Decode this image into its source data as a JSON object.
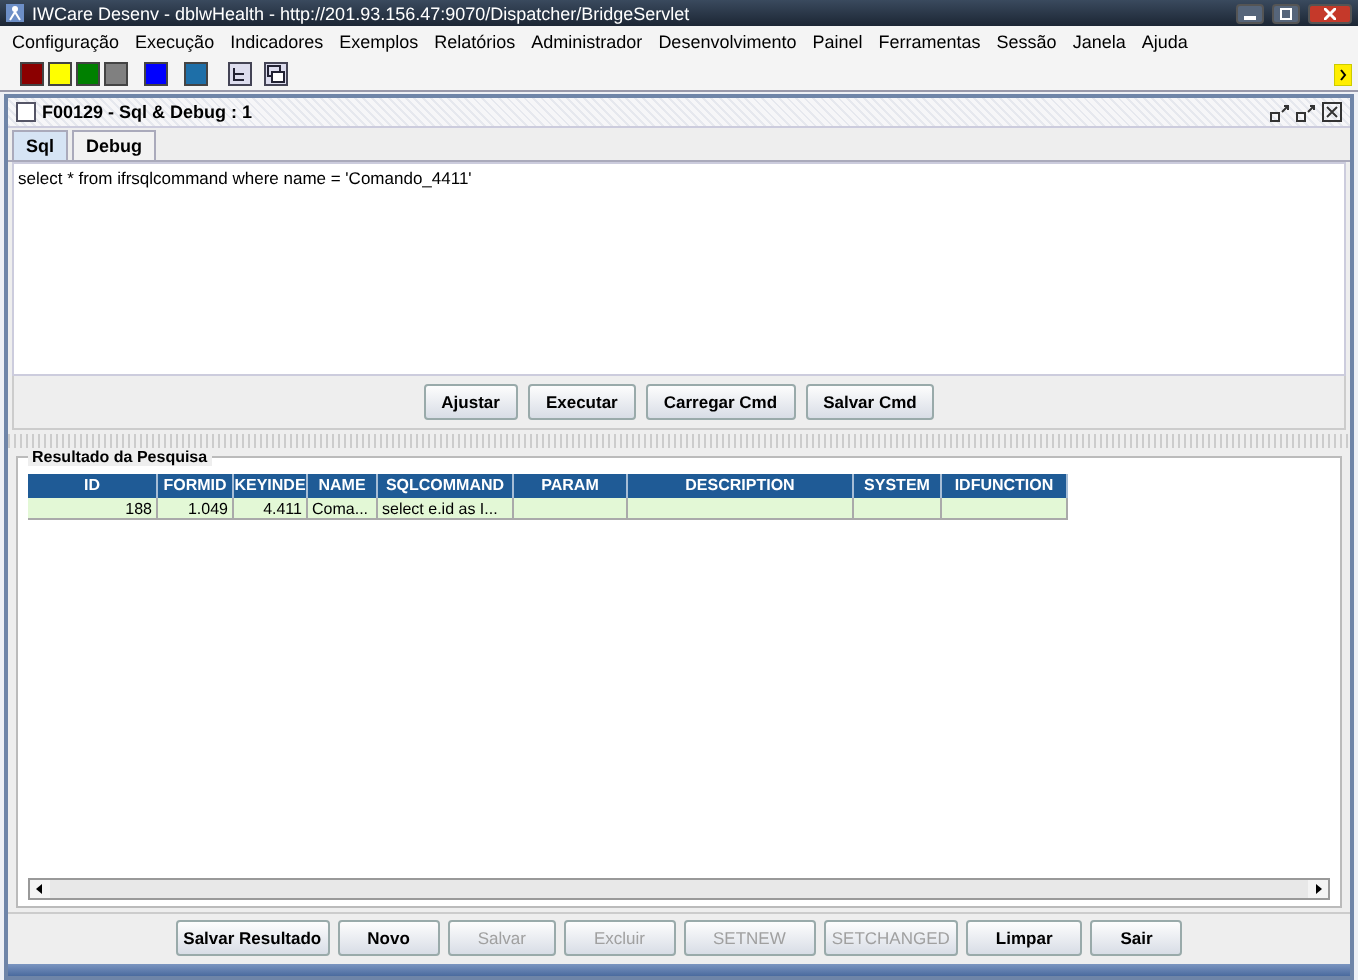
{
  "window": {
    "title": "IWCare Desenv - dblwHealth - http://201.93.156.47:9070/Dispatcher/BridgeServlet"
  },
  "menu": [
    "Configuração",
    "Execução",
    "Indicadores",
    "Exemplos",
    "Relatórios",
    "Administrador",
    "Desenvolvimento",
    "Painel",
    "Ferramentas",
    "Sessão",
    "Janela",
    "Ajuda"
  ],
  "toolbar": {
    "colors": [
      {
        "color": "#8b0000"
      },
      {
        "color": "#ffff00"
      },
      {
        "color": "#008000"
      },
      {
        "color": "#808080"
      },
      {
        "color": "#0000ff"
      },
      {
        "color": "#1e6fa8"
      }
    ]
  },
  "frame": {
    "title": "F00129 - Sql & Debug : 1",
    "tabs": [
      {
        "label": "Sql",
        "selected": true
      },
      {
        "label": "Debug",
        "selected": false
      }
    ],
    "query": "select * from ifrsqlcommand where name = 'Comando_4411'",
    "query_buttons": [
      "Ajustar",
      "Executar",
      "Carregar Cmd",
      "Salvar Cmd"
    ],
    "results": {
      "title": "Resultado da Pesquisa",
      "columns": [
        "ID",
        "FORMID",
        "KEYINDE",
        "NAME",
        "SQLCOMMAND",
        "PARAM",
        "DESCRIPTION",
        "SYSTEM",
        "IDFUNCTION"
      ],
      "rows": [
        [
          "188",
          "1.049",
          "4.411",
          "Coma...",
          "select e.id as I...",
          "",
          "",
          "",
          ""
        ]
      ]
    },
    "buttons": [
      {
        "label": "Salvar Resultado",
        "disabled": false
      },
      {
        "label": "Novo",
        "disabled": false
      },
      {
        "label": "Salvar",
        "disabled": true
      },
      {
        "label": "Excluir",
        "disabled": true
      },
      {
        "label": "SETNEW",
        "disabled": true
      },
      {
        "label": "SETCHANGED",
        "disabled": true
      },
      {
        "label": "Limpar",
        "disabled": false
      },
      {
        "label": "Sair",
        "disabled": false
      }
    ]
  }
}
